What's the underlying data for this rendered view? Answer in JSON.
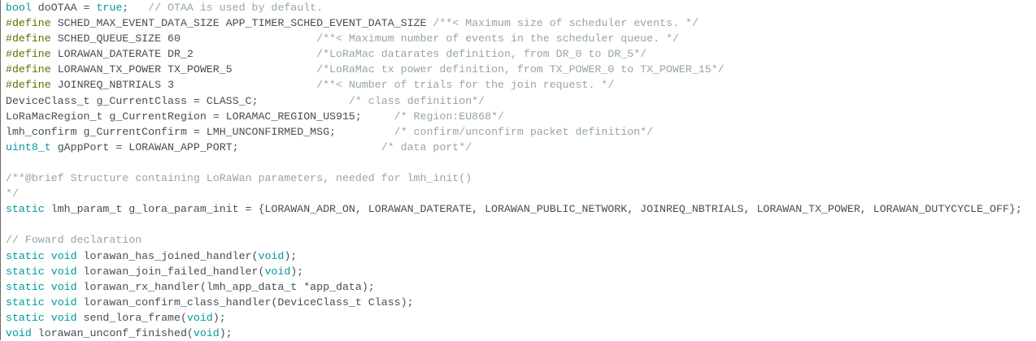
{
  "colors": {
    "keyword": "#00979c",
    "preprocessor": "#5e6d03",
    "comment": "#95a5a6",
    "text": "#434f54"
  },
  "code": {
    "lines": [
      [
        {
          "t": "bool",
          "c": "kw"
        },
        {
          "t": " doOTAA = ",
          "c": "tx"
        },
        {
          "t": "true",
          "c": "kw"
        },
        {
          "t": ";   ",
          "c": "tx"
        },
        {
          "t": "// OTAA is used by default.",
          "c": "cm"
        }
      ],
      [
        {
          "t": "#define",
          "c": "pp"
        },
        {
          "t": " SCHED_MAX_EVENT_DATA_SIZE APP_TIMER_SCHED_EVENT_DATA_SIZE ",
          "c": "tx"
        },
        {
          "t": "/**< Maximum size of scheduler events. */",
          "c": "cm"
        }
      ],
      [
        {
          "t": "#define",
          "c": "pp"
        },
        {
          "t": " SCHED_QUEUE_SIZE 60                     ",
          "c": "tx"
        },
        {
          "t": "/**< Maximum number of events in the scheduler queue. */",
          "c": "cm"
        }
      ],
      [
        {
          "t": "#define",
          "c": "pp"
        },
        {
          "t": " LORAWAN_DATERATE DR_2                   ",
          "c": "tx"
        },
        {
          "t": "/*LoRaMac datarates definition, from DR_0 to DR_5*/",
          "c": "cm"
        }
      ],
      [
        {
          "t": "#define",
          "c": "pp"
        },
        {
          "t": " LORAWAN_TX_POWER TX_POWER_5             ",
          "c": "tx"
        },
        {
          "t": "/*LoRaMac tx power definition, from TX_POWER_0 to TX_POWER_15*/",
          "c": "cm"
        }
      ],
      [
        {
          "t": "#define",
          "c": "pp"
        },
        {
          "t": " JOINREQ_NBTRIALS 3                      ",
          "c": "tx"
        },
        {
          "t": "/**< Number of trials for the join request. */",
          "c": "cm"
        }
      ],
      [
        {
          "t": "DeviceClass_t g_CurrentClass = CLASS_C;              ",
          "c": "tx"
        },
        {
          "t": "/* class definition*/",
          "c": "cm"
        }
      ],
      [
        {
          "t": "LoRaMacRegion_t g_CurrentRegion = LORAMAC_REGION_US915;     ",
          "c": "tx"
        },
        {
          "t": "/* Region:EU868*/",
          "c": "cm"
        }
      ],
      [
        {
          "t": "lmh_confirm g_CurrentConfirm = LMH_UNCONFIRMED_MSG;         ",
          "c": "tx"
        },
        {
          "t": "/* confirm/unconfirm packet definition*/",
          "c": "cm"
        }
      ],
      [
        {
          "t": "uint8_t",
          "c": "kw"
        },
        {
          "t": " gAppPort = LORAWAN_APP_PORT;                      ",
          "c": "tx"
        },
        {
          "t": "/* data port*/",
          "c": "cm"
        }
      ],
      [],
      [
        {
          "t": "/**@brief Structure containing LoRaWan parameters, needed for lmh_init()",
          "c": "cm"
        }
      ],
      [
        {
          "t": "*/",
          "c": "cm"
        }
      ],
      [
        {
          "t": "static",
          "c": "kw"
        },
        {
          "t": " lmh_param_t g_lora_param_init = {LORAWAN_ADR_ON, LORAWAN_DATERATE, LORAWAN_PUBLIC_NETWORK, JOINREQ_NBTRIALS, LORAWAN_TX_POWER, LORAWAN_DUTYCYCLE_OFF};",
          "c": "tx"
        }
      ],
      [],
      [
        {
          "t": "// Foward declaration",
          "c": "cm"
        }
      ],
      [
        {
          "t": "static",
          "c": "kw"
        },
        {
          "t": " ",
          "c": "tx"
        },
        {
          "t": "void",
          "c": "kw"
        },
        {
          "t": " lorawan_has_joined_handler(",
          "c": "tx"
        },
        {
          "t": "void",
          "c": "kw"
        },
        {
          "t": ");",
          "c": "tx"
        }
      ],
      [
        {
          "t": "static",
          "c": "kw"
        },
        {
          "t": " ",
          "c": "tx"
        },
        {
          "t": "void",
          "c": "kw"
        },
        {
          "t": " lorawan_join_failed_handler(",
          "c": "tx"
        },
        {
          "t": "void",
          "c": "kw"
        },
        {
          "t": ");",
          "c": "tx"
        }
      ],
      [
        {
          "t": "static",
          "c": "kw"
        },
        {
          "t": " ",
          "c": "tx"
        },
        {
          "t": "void",
          "c": "kw"
        },
        {
          "t": " lorawan_rx_handler(lmh_app_data_t *app_data);",
          "c": "tx"
        }
      ],
      [
        {
          "t": "static",
          "c": "kw"
        },
        {
          "t": " ",
          "c": "tx"
        },
        {
          "t": "void",
          "c": "kw"
        },
        {
          "t": " lorawan_confirm_class_handler(DeviceClass_t Class);",
          "c": "tx"
        }
      ],
      [
        {
          "t": "static",
          "c": "kw"
        },
        {
          "t": " ",
          "c": "tx"
        },
        {
          "t": "void",
          "c": "kw"
        },
        {
          "t": " send_lora_frame(",
          "c": "tx"
        },
        {
          "t": "void",
          "c": "kw"
        },
        {
          "t": ");",
          "c": "tx"
        }
      ],
      [
        {
          "t": "void",
          "c": "kw"
        },
        {
          "t": " lorawan_unconf_finished(",
          "c": "tx"
        },
        {
          "t": "void",
          "c": "kw"
        },
        {
          "t": ");",
          "c": "tx"
        }
      ]
    ]
  }
}
